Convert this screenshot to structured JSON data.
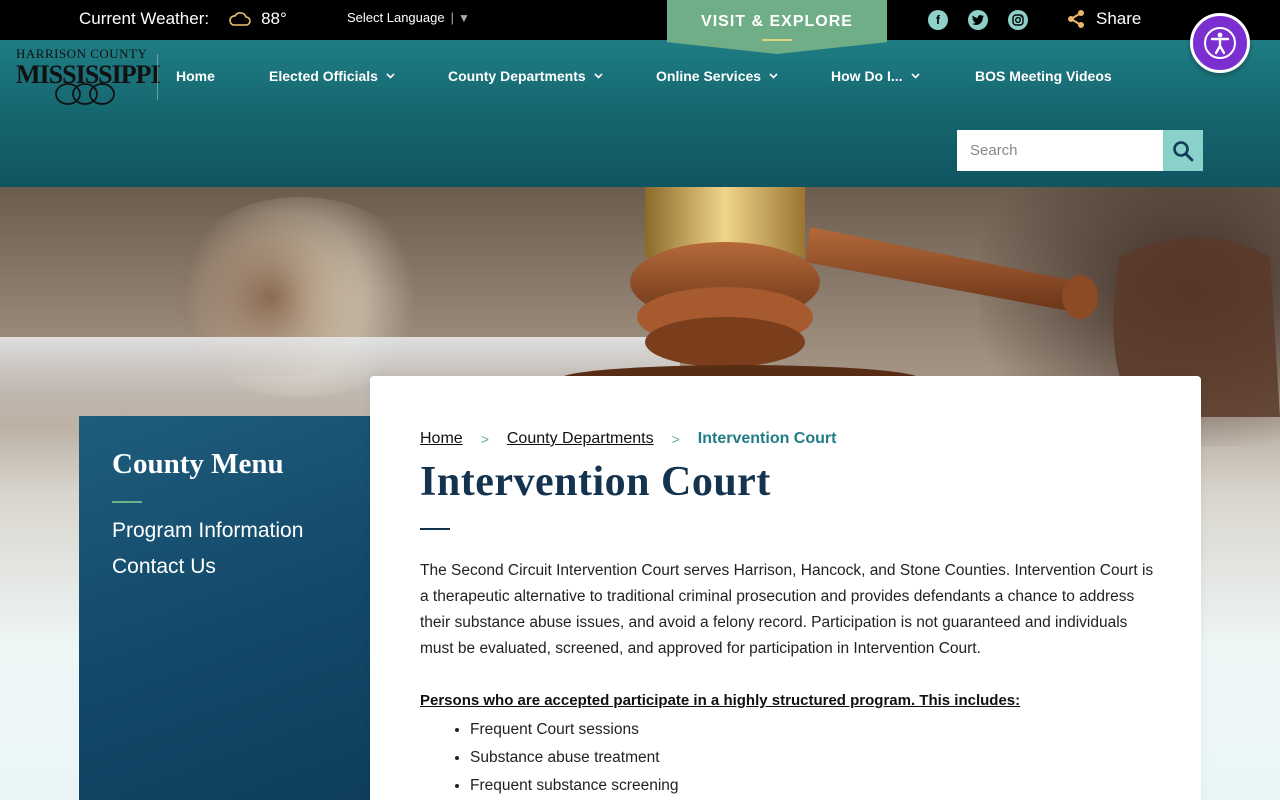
{
  "topbar": {
    "weather_label": "Current Weather:",
    "temperature": "88°",
    "language_label": "Select Language",
    "visit_label": "VISIT & EXPLORE",
    "share_label": "Share",
    "social_icons": [
      "facebook-icon",
      "twitter-icon",
      "instagram-icon"
    ]
  },
  "accessibility": {
    "icon": "accessibility-icon",
    "color": "#7c2fd1"
  },
  "logo": {
    "line1": "HARRISON COUNTY",
    "line2": "MISSISSIPPI"
  },
  "nav": {
    "items": [
      {
        "label": "Home",
        "dropdown": false
      },
      {
        "label": "Elected Officials",
        "dropdown": true
      },
      {
        "label": "County Departments",
        "dropdown": true
      },
      {
        "label": "Online Services",
        "dropdown": true
      },
      {
        "label": "How Do I...",
        "dropdown": true
      },
      {
        "label": "BOS Meeting Videos",
        "dropdown": false
      }
    ]
  },
  "search": {
    "placeholder": "Search",
    "value": ""
  },
  "sidebar": {
    "title": "County Menu",
    "links": [
      "Program Information",
      "Contact Us"
    ]
  },
  "breadcrumb": {
    "home": "Home",
    "parent": "County Departments",
    "current": "Intervention Court",
    "separator": ">"
  },
  "content": {
    "title": "Intervention Court",
    "intro": "The Second Circuit Intervention Court serves Harrison, Hancock, and Stone Counties. Intervention Court is a therapeutic alternative to traditional criminal prosecution and provides defendants a chance to address their substance abuse issues, and avoid a felony record. Participation is not guaranteed and individuals must be evaluated, screened, and approved for participation in Intervention Court.",
    "subheading": "Persons who are accepted participate in a highly structured program. This includes:",
    "list": [
      "Frequent Court sessions",
      "Substance abuse treatment",
      "Frequent substance screening"
    ]
  },
  "colors": {
    "header_teal": "#1f7d84",
    "accent_green": "#6fae86",
    "title_navy": "#14334f",
    "sidebar_blue": "#14496a"
  }
}
